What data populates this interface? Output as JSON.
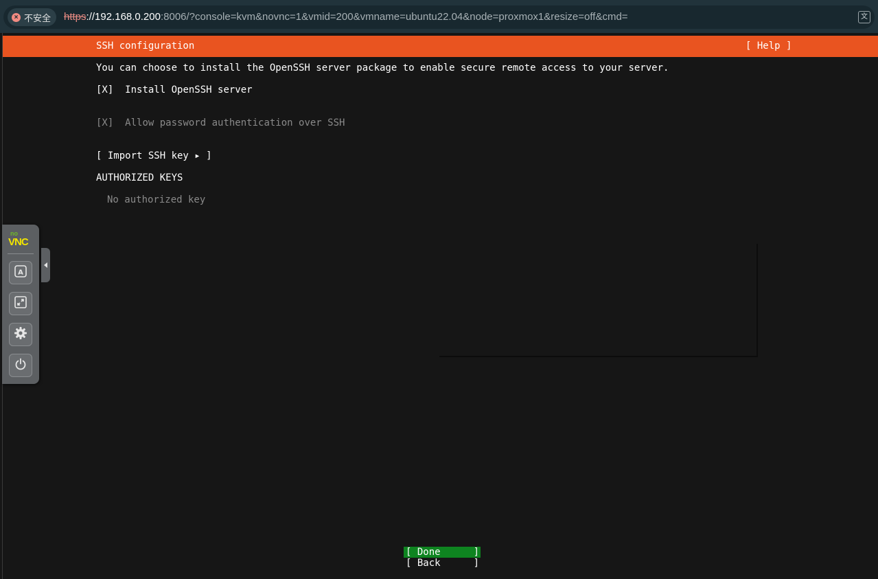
{
  "browser": {
    "security_label": "不安全",
    "url_scheme": "https",
    "url_host": "://192.168.0.200",
    "url_rest": ":8006/?console=kvm&novnc=1&vmid=200&vmname=ubuntu22.04&node=proxmox1&resize=off&cmd="
  },
  "installer": {
    "title": "SSH configuration",
    "help_label": "[ Help ]",
    "intro": "You can choose to install the OpenSSH server package to enable secure remote access to your server.",
    "install_openssh": {
      "checkbox": "[X]",
      "label": "Install OpenSSH server"
    },
    "allow_password": {
      "checkbox": "[X]",
      "label": "Allow password authentication over SSH"
    },
    "import_key_label": "[ Import SSH key ▸ ]",
    "authorized_keys_heading": "AUTHORIZED KEYS",
    "no_key_text": "No authorized key",
    "done_button": {
      "open": "[ Done",
      "close": "]"
    },
    "back_button": {
      "open": "[ Back",
      "close": "]"
    }
  },
  "novnc": {
    "logo_top": "no",
    "logo_main": "VNC",
    "buttons": [
      "keyboard-icon",
      "fullscreen-icon",
      "settings-icon",
      "power-icon"
    ]
  },
  "colors": {
    "header_orange": "#e95420",
    "done_green": "#0e8420",
    "console_bg": "#161616",
    "addrbar_bg": "#21333b"
  }
}
